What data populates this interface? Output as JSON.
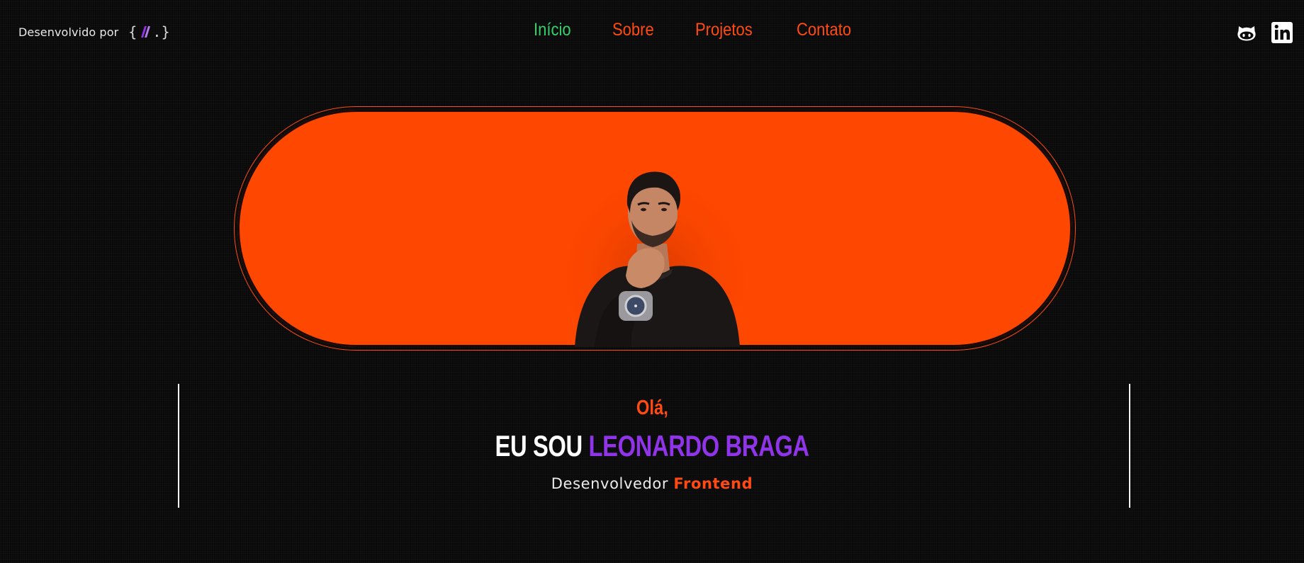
{
  "header": {
    "brand_text": "Desenvolvido por",
    "brand_logo_open": "{",
    "brand_logo_close": ".}",
    "nav": [
      {
        "label": "Início",
        "active": true
      },
      {
        "label": "Sobre",
        "active": false
      },
      {
        "label": "Projetos",
        "active": false
      },
      {
        "label": "Contato",
        "active": false
      }
    ],
    "socials": [
      {
        "icon": "github-icon"
      },
      {
        "icon": "linkedin-icon"
      }
    ]
  },
  "hero": {
    "greeting": "Olá,",
    "headline_prefix": "EU SOU",
    "headline_name": "LEONARDO BRAGA",
    "role_prefix": "Desenvolvedor",
    "role_accent": "Frontend"
  },
  "colors": {
    "background": "#0c0b0b",
    "accent_orange": "#ff4a12",
    "hero_fill": "#fe4700",
    "active_nav": "#34d16b",
    "name_purple": "#8f34e8"
  }
}
